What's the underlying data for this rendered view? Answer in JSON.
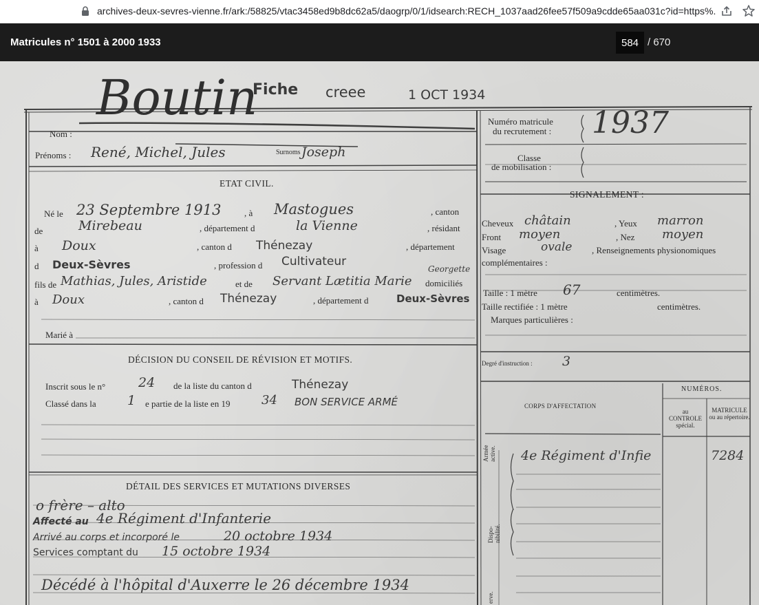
{
  "browser": {
    "url": "archives-deux-sevres-vienne.fr/ark:/58825/vtac3458ed9b8dc62a5/daogrp/0/1/idsearch:RECH_1037aad26fee57f509a9cdde65aa031c?id=https%..."
  },
  "viewer": {
    "title": "Matricules n° 1501 à 2000 1933",
    "page_current": "584",
    "page_total": "/ 670"
  },
  "document": {
    "stamp_fiche": "Fiche",
    "stamp_creee": "creee",
    "stamp_date": "1 OCT 1934",
    "surname_hw": "Boutin",
    "label_nom": "Nom :",
    "label_prenoms": "Prénoms :",
    "prenoms_hw": "René, Michel, Jules",
    "label_surnoms": "Surnoms",
    "surnoms_hw": "Joseph",
    "label_numero_matricule": "Numéro matricule",
    "label_du_recrutement": "du recrutement :",
    "matricule_hw": "1937",
    "label_classe": "Classe",
    "label_de_mobilisation": "de mobilisation :",
    "heading_etat_civil": "ETAT CIVIL.",
    "heading_signalement": "SIGNALEMENT :",
    "label_ne_le": "Né le",
    "birth_date_hw": "23 Septembre 1913",
    "label_a": ", à",
    "birth_place_hw": "Mastogues",
    "label_canton": ", canton",
    "label_de": "de",
    "canton_hw": "Mirebeau",
    "label_departement_d": ", département d",
    "departement_hw": "la Vienne",
    "label_residant": ", résidant",
    "label_a2": "à",
    "residence_hw": "Doux",
    "label_canton_d": ", canton d",
    "residence_canton_stamp": "Thénezay",
    "label_departement": ", département",
    "label_d": "d",
    "residence_dept_stamp": "Deux-Sèvres",
    "label_profession": ", profession d",
    "profession_stamp": "Cultivateur",
    "label_fils_de": "fils de",
    "father_hw": "Mathias, Jules, Aristide",
    "label_et_de": "et de",
    "mother_hw": "Servant Lætitia Marie",
    "mother_extra_hw": "Georgette",
    "label_domicilies": "domiciliés",
    "label_a3": "à",
    "parents_residence_hw": "Doux",
    "label_canton_d2": ", canton d",
    "parents_canton_stamp": "Thénezay",
    "label_departement_d2": ", département d",
    "parents_dept_stamp": "Deux-Sèvres",
    "label_marie_a": "Marié à",
    "label_cheveux": "Cheveux",
    "cheveux_hw": "châtain",
    "label_yeux": ", Yeux",
    "yeux_hw": "marron",
    "label_front": "Front",
    "front_hw": "moyen",
    "label_nez": ", Nez",
    "nez_hw": "moyen",
    "label_visage": "Visage",
    "visage_hw": "ovale",
    "label_renseignements": ", Renseignements physionomiques",
    "label_complementaires": "complémentaires :",
    "label_taille": "Taille : 1 mètre",
    "taille_hw": "67",
    "label_centimetres": "centimètres.",
    "label_taille_rectifiee": "Taille rectifiée : 1 mètre",
    "label_centimetres2": "centimètres.",
    "label_marques": "Marques particulières :",
    "heading_decision": "DÉCISION DU CONSEIL DE RÉVISION ET MOTIFS.",
    "label_inscrit_sous": "Inscrit sous le n°",
    "inscrit_num_hw": "24",
    "label_de_la_liste": "de la liste du canton d",
    "inscrit_canton_stamp": "Thénezay",
    "label_classe_dans": "Classé dans la",
    "classe_partie_hw": "1",
    "label_partie": "e partie de la liste en 19",
    "classe_year_hw": "34",
    "classe_stamp": "BON SERVICE ARMÉ",
    "label_degre": "Degré d'instruction :",
    "degre_hw": "3",
    "heading_corps": "CORPS D'AFFECTATION",
    "heading_numeros": "NUMÉROS.",
    "label_au_controle": "au CONTROLE spécial.",
    "label_matricule_repertoire": "MATRICULE ou au répertoire.",
    "label_armee_active": "Armée active.",
    "corps_hw": "4e Régiment d'Infie",
    "numero_hw": "7284",
    "label_disponibilite": "Dispo-nibilité.",
    "label_reserve": "erve.",
    "heading_detail": "DÉTAIL DES SERVICES ET MUTATIONS DIVERSES",
    "detail_line1_hw": "o frère – alto",
    "detail_affecte_stamp": "Affecté au",
    "detail_affecte_hw": "4e Régiment d'Infanterie",
    "detail_arrive_stamp": "Arrivé au corps et incorporé le",
    "detail_arrive_hw": "20 octobre 1934",
    "detail_services_stamp": "Services comptant du",
    "detail_services_hw": "15 octobre 1934",
    "detail_decede_hw": "Décédé à l'hôpital d'Auxerre le 26 décembre 1934"
  }
}
